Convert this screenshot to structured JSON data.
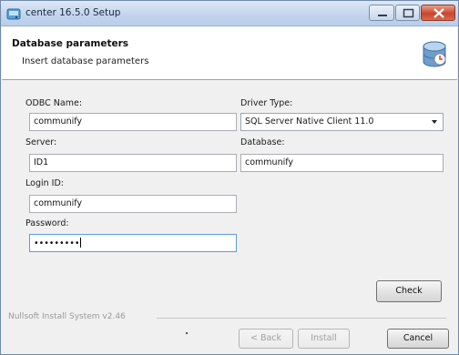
{
  "window": {
    "title": "center 16.5.0 Setup",
    "icon": "installer-app-icon",
    "controls": [
      "minimize-icon",
      "maximize-icon",
      "close-icon"
    ]
  },
  "header": {
    "title": "Database parameters",
    "subtitle": "Insert database parameters",
    "icon": "database-icon"
  },
  "form": {
    "odbc_name": {
      "label": "ODBC Name:",
      "value": "communify"
    },
    "driver_type": {
      "label": "Driver Type:",
      "value": "SQL Server Native Client 11.0"
    },
    "server": {
      "label": "Server:",
      "value": "ID1"
    },
    "database": {
      "label": "Database:",
      "value": "communify"
    },
    "login_id": {
      "label": "Login ID:",
      "value": "communify"
    },
    "password": {
      "label": "Password:",
      "value": "•••••••••"
    }
  },
  "buttons": {
    "check": "Check",
    "back": "< Back",
    "install": "Install",
    "cancel": "Cancel"
  },
  "footer": {
    "brand": "Nullsoft Install System v2.46"
  },
  "colors": {
    "titlebar": "#c3d6ee",
    "close_button": "#c9452c",
    "focus_border": "#5e9bd6"
  }
}
